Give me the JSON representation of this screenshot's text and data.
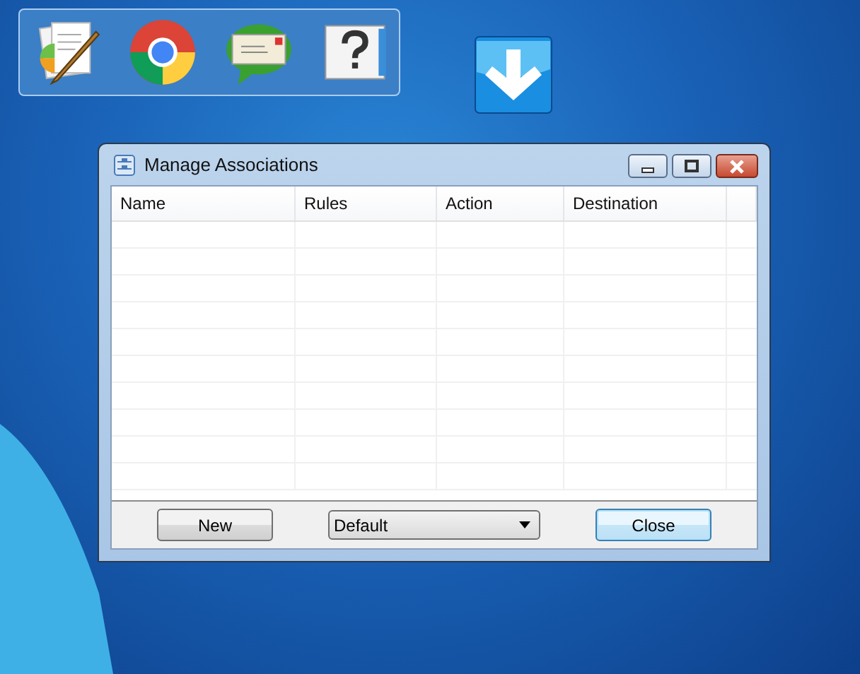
{
  "window": {
    "title": "Manage Associations"
  },
  "table": {
    "columns": [
      {
        "label": "Name"
      },
      {
        "label": "Rules"
      },
      {
        "label": "Action"
      },
      {
        "label": "Destination"
      }
    ]
  },
  "footer": [
    {
      "kind": "button",
      "label": "New",
      "focused": false
    },
    {
      "kind": "dropdown",
      "value": "Default"
    },
    {
      "kind": "button",
      "label": "Close",
      "focused": true
    }
  ]
}
